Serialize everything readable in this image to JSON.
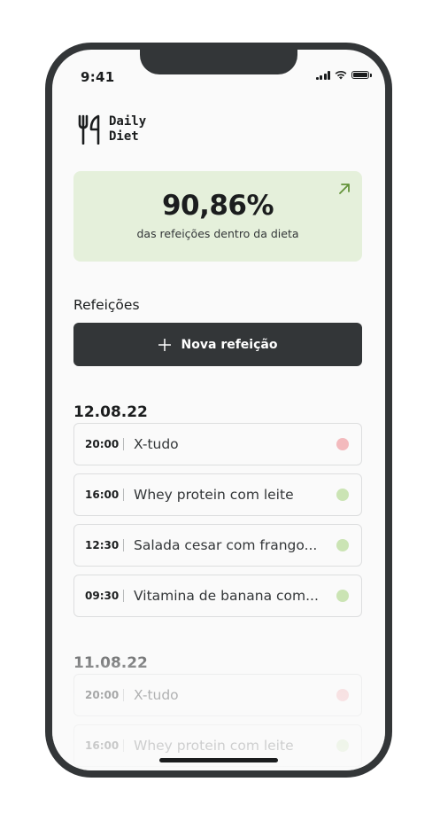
{
  "status_bar": {
    "time": "9:41"
  },
  "app": {
    "logo_line1": "Daily",
    "logo_line2": "Diet"
  },
  "stats": {
    "percentage": "90,86%",
    "description": "das refeições dentro da dieta"
  },
  "meals_section": {
    "title": "Refeições",
    "new_button": "Nova refeição"
  },
  "days": [
    {
      "date": "12.08.22",
      "meals": [
        {
          "time": "20:00",
          "name": "X-tudo",
          "in_diet": false
        },
        {
          "time": "16:00",
          "name": "Whey protein com leite",
          "in_diet": true
        },
        {
          "time": "12:30",
          "name": "Salada cesar com frango...",
          "in_diet": true
        },
        {
          "time": "09:30",
          "name": "Vitamina de banana com...",
          "in_diet": true
        }
      ]
    },
    {
      "date": "11.08.22",
      "meals": [
        {
          "time": "20:00",
          "name": "X-tudo",
          "in_diet": false
        },
        {
          "time": "16:00",
          "name": "Whey protein com leite",
          "in_diet": true
        }
      ]
    }
  ],
  "colors": {
    "in_diet_dot": "#CBE4B4",
    "off_diet_dot": "#F3BABD",
    "stats_bg": "#E5F0DB",
    "accent_green": "#639339",
    "dark": "#333638"
  }
}
